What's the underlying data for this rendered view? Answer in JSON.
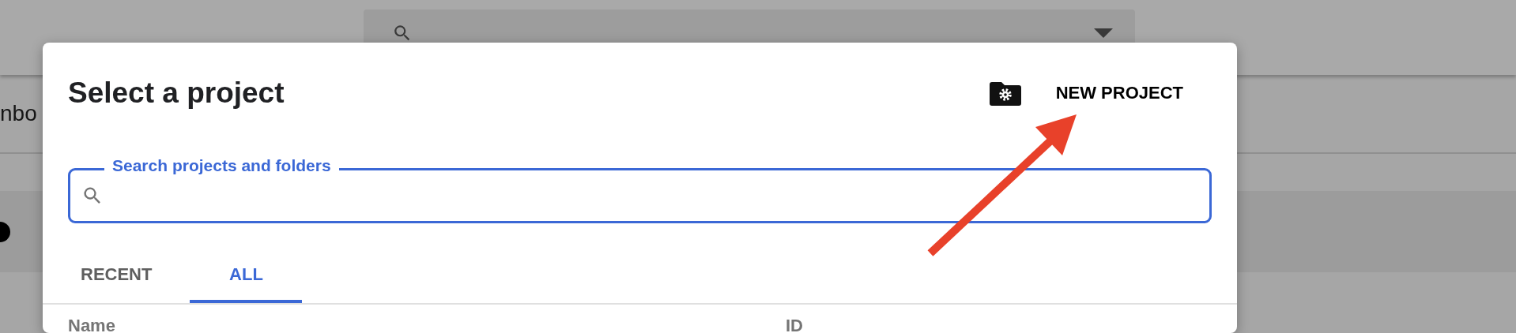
{
  "background": {
    "partial_title": "nbo"
  },
  "dialog": {
    "title": "Select a project",
    "new_project_button": "NEW PROJECT",
    "search": {
      "label": "Search projects and folders",
      "focused": true
    },
    "tabs": [
      {
        "label": "RECENT",
        "selected": false
      },
      {
        "label": "ALL",
        "selected": true
      }
    ],
    "table": {
      "columns": [
        "Name",
        "ID"
      ]
    }
  }
}
